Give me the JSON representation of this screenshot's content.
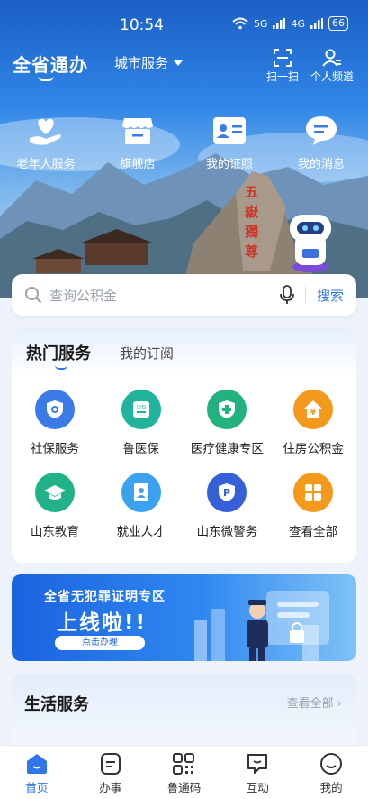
{
  "status_bar": {
    "time": "10:54",
    "network_1": "5G",
    "network_2": "4G",
    "battery": "66"
  },
  "header": {
    "brand": "全省通办",
    "city_selector": "城市服务",
    "scan_label": "扫一扫",
    "personal_label": "个人频道"
  },
  "quick_actions": [
    {
      "label": "老年人服务",
      "icon": "heart-hand-icon"
    },
    {
      "label": "旗舰店",
      "icon": "store-icon"
    },
    {
      "label": "我的证照",
      "icon": "id-card-icon"
    },
    {
      "label": "我的消息",
      "icon": "chat-bubble-icon"
    }
  ],
  "search": {
    "placeholder": "查询公积金",
    "button": "搜索"
  },
  "hot_services": {
    "tab_active": "热门服务",
    "tab_other": "我的订阅",
    "items": [
      {
        "label": "社保服务",
        "icon": "shield-icon",
        "color": "#3a7be8"
      },
      {
        "label": "鲁医保",
        "icon": "medical-insurance-icon",
        "color": "#1fb49b"
      },
      {
        "label": "医疗健康专区",
        "icon": "medical-cross-icon",
        "color": "#21b27e"
      },
      {
        "label": "住房公积金",
        "icon": "house-yuan-icon",
        "color": "#f39a1c"
      },
      {
        "label": "山东教育",
        "icon": "graduation-cap-icon",
        "color": "#22b28a"
      },
      {
        "label": "就业人才",
        "icon": "employee-badge-icon",
        "color": "#3aa2ee"
      },
      {
        "label": "山东微警务",
        "icon": "police-p-icon",
        "color": "#3560d8"
      },
      {
        "label": "查看全部",
        "icon": "grid-apps-icon",
        "color": "#f39a1c"
      }
    ]
  },
  "banner": {
    "line1": "全省无犯罪证明专区",
    "line2": "上线啦!!",
    "cta": "点击办理"
  },
  "life_services": {
    "title": "生活服务",
    "more": "查看全部 ›"
  },
  "tabbar": [
    {
      "label": "首页",
      "icon": "home-icon",
      "active": true
    },
    {
      "label": "办事",
      "icon": "tasks-icon",
      "active": false
    },
    {
      "label": "鲁通码",
      "icon": "qr-code-icon",
      "active": false
    },
    {
      "label": "互动",
      "icon": "interaction-icon",
      "active": false
    },
    {
      "label": "我的",
      "icon": "profile-smile-icon",
      "active": false
    }
  ]
}
